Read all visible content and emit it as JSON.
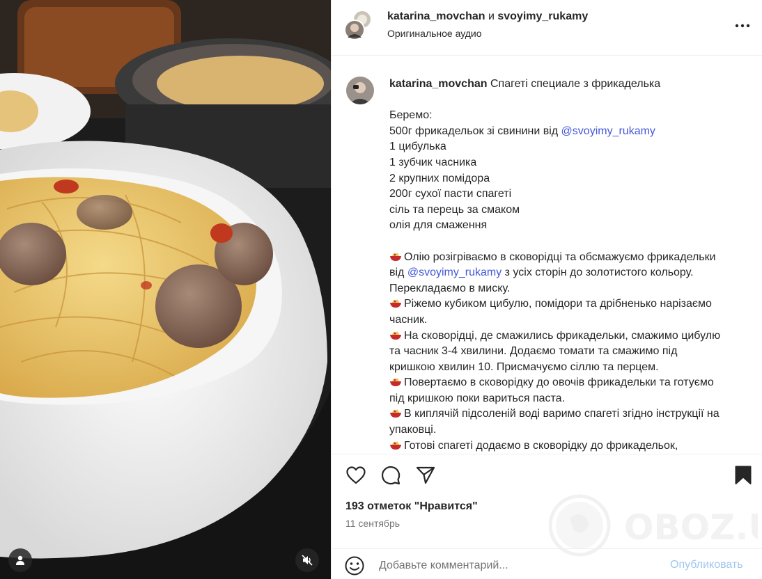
{
  "post": {
    "author": "katarina_movchan",
    "and_word": "и",
    "coauthor": "svoyimy_rukamy",
    "audio": "Оригинальное аудио"
  },
  "caption": {
    "username": "katarina_movchan",
    "title": "Спагеті специале з фрикаделька",
    "lines": {
      "l1": "Беремо:",
      "l2_pre": "500г фрикадельок зі свинини від ",
      "l2_mention": "@svoyimy_rukamy",
      "l3": "1 цибулька",
      "l4": "1 зубчик часника",
      "l5": "2 крупних помідора",
      "l6": "200г сухої пасти спагеті",
      "l7": "сіль та перець за смаком",
      "l8": "олія для смаження"
    },
    "steps": {
      "s1_a": "Олію розігріваємо в сковорідці та обсмажуємо фрикадельки",
      "s1_b_pre": "від ",
      "s1_b_mention": "@svoyimy_rukamy",
      "s1_b_post": " з усіх сторін до золотистого кольору.",
      "s1_c": "Перекладаємо в миску.",
      "s2_a": "Ріжемо кубиком цибулю, помідори та дрібненько нарізаємо",
      "s2_b": "часник.",
      "s3_a": "На сковорідці, де смажились фрикадельки, смажимо цибулю",
      "s3_b": "та часник 3-4 хвилини. Додаємо томати та смажимо під",
      "s3_c": "кришкою хвилин 10. Присмачуємо сіллю та перцем.",
      "s4_a": "Повертаємо в сковорідку до овочів фрикадельки та готуємо",
      "s4_b": "під кришкою поки вариться паста.",
      "s5_a": "В киплячій підсоленій воді варимо спагеті згідно інструкції на",
      "s5_b": "упаковці.",
      "s6_a": "Готові спагеті додаємо в сковорідку до фрикадельок,"
    }
  },
  "stats": {
    "likes": "193 отметок \"Нравится\"",
    "date": "11 сентябрь"
  },
  "comment": {
    "placeholder": "Добавьте комментарий...",
    "publish": "Опубликовать"
  },
  "watermark": {
    "text": "OBOZ.UA"
  },
  "icons": {
    "like": "heart-icon",
    "comment": "speech-bubble-icon",
    "share": "paper-plane-icon",
    "save": "bookmark-icon",
    "emoji": "smiley-icon",
    "step_bullet": "spaghetti-bowl-emoji",
    "tagged_users": "person-icon",
    "mute": "speaker-muted-icon",
    "more": "more-dots-icon"
  },
  "colors": {
    "mention": "#4458d6",
    "publish_disabled": "#9fc6f0",
    "secondary_text": "#737373",
    "border": "#efefef"
  }
}
